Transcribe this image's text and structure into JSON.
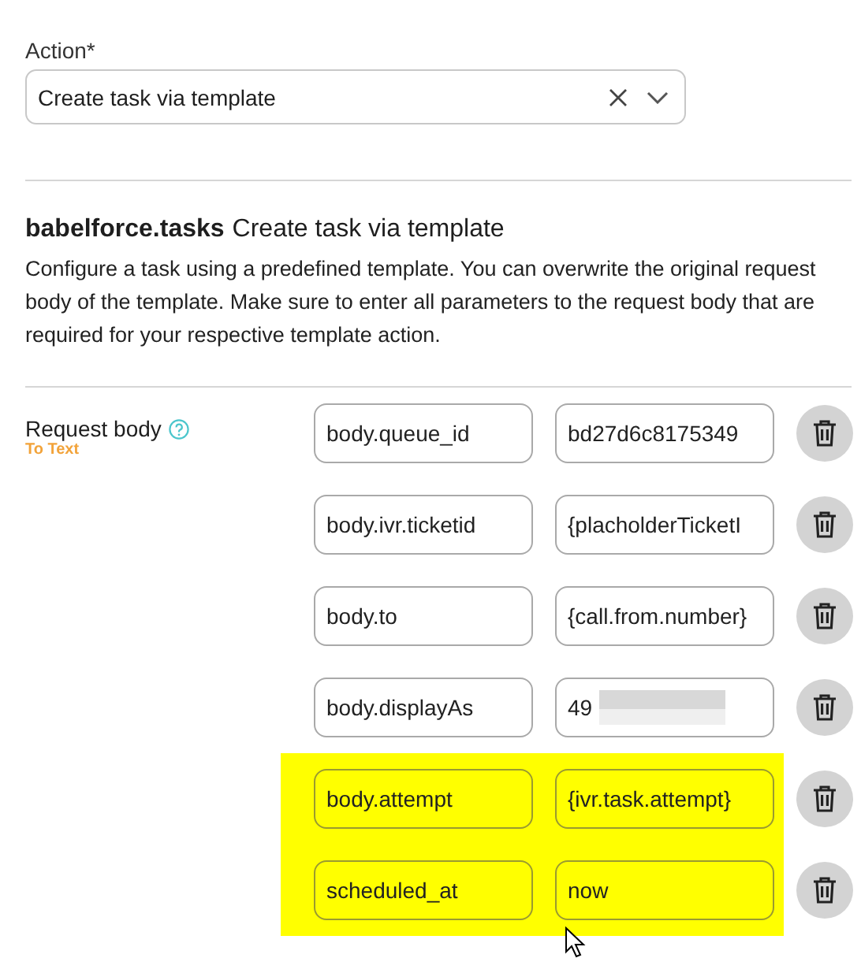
{
  "action_field": {
    "label": "Action*",
    "value": "Create task via template"
  },
  "section": {
    "service": "babelforce.tasks",
    "title": "Create task via template",
    "description": "Configure a task using a predefined template. You can overwrite the original request body of the template. Make sure to enter all parameters to the request body that are required for your respective template action."
  },
  "request_body": {
    "label": "Request body",
    "link": "To Text",
    "rows": [
      {
        "key": "body.queue_id",
        "value": "bd27d6c8175349",
        "redacted": false,
        "highlighted": false
      },
      {
        "key": "body.ivr.ticketid",
        "value": "{placholderTicketI",
        "redacted": false,
        "highlighted": false
      },
      {
        "key": "body.to",
        "value": "{call.from.number}",
        "redacted": false,
        "highlighted": false
      },
      {
        "key": "body.displayAs",
        "value": "49",
        "redacted": true,
        "highlighted": false
      },
      {
        "key": "body.attempt",
        "value": "{ivr.task.attempt}",
        "redacted": false,
        "highlighted": true
      },
      {
        "key": "scheduled_at",
        "value": "now",
        "redacted": false,
        "highlighted": true
      }
    ]
  }
}
